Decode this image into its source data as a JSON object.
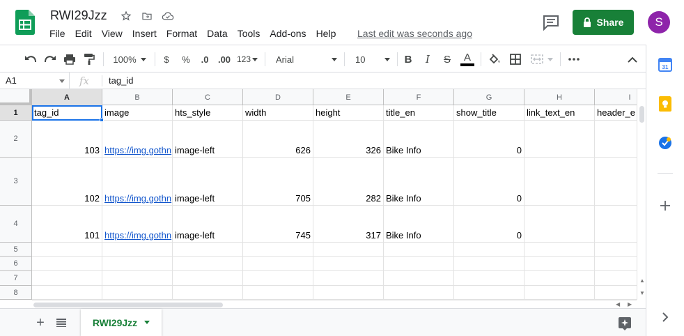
{
  "app": {
    "doc_title": "RWI29Jzz",
    "menu": [
      "File",
      "Edit",
      "View",
      "Insert",
      "Format",
      "Data",
      "Tools",
      "Add-ons",
      "Help"
    ],
    "last_edit": "Last edit was seconds ago",
    "share_label": "Share",
    "avatar_letter": "S",
    "brand_color": "#188038",
    "avatar_color": "#8e24aa"
  },
  "toolbar": {
    "zoom": "100%",
    "currency": "$",
    "percent": "%",
    "decrease_decimal": ".0",
    "increase_decimal": ".00",
    "more_formats": "123",
    "font": "Arial",
    "font_size": "10",
    "bold": "B",
    "italic": "I",
    "strikethrough": "S",
    "text_color": "A"
  },
  "formula_bar": {
    "cell_ref": "A1",
    "fx": "fx",
    "value": "tag_id"
  },
  "grid": {
    "columns": [
      "A",
      "B",
      "C",
      "D",
      "E",
      "F",
      "G",
      "H",
      "I"
    ],
    "row_numbers": [
      "1",
      "2",
      "3",
      "4",
      "5",
      "6",
      "7",
      "8"
    ],
    "header_row": [
      "tag_id",
      "image",
      "hts_style",
      "width",
      "height",
      "title_en",
      "show_title",
      "link_text_en",
      "header_e"
    ],
    "rows": [
      [
        "103",
        "https://img.gothn",
        "image-left",
        "626",
        "326",
        "Bike Info",
        "0",
        "",
        ""
      ],
      [
        "102",
        "https://img.gothn",
        "image-left",
        "705",
        "282",
        "Bike Info",
        "0",
        "",
        ""
      ],
      [
        "101",
        "https://img.gothn",
        "image-left",
        "745",
        "317",
        "Bike Info",
        "0",
        "",
        ""
      ]
    ]
  },
  "sheets": {
    "active": "RWI29Jzz"
  }
}
